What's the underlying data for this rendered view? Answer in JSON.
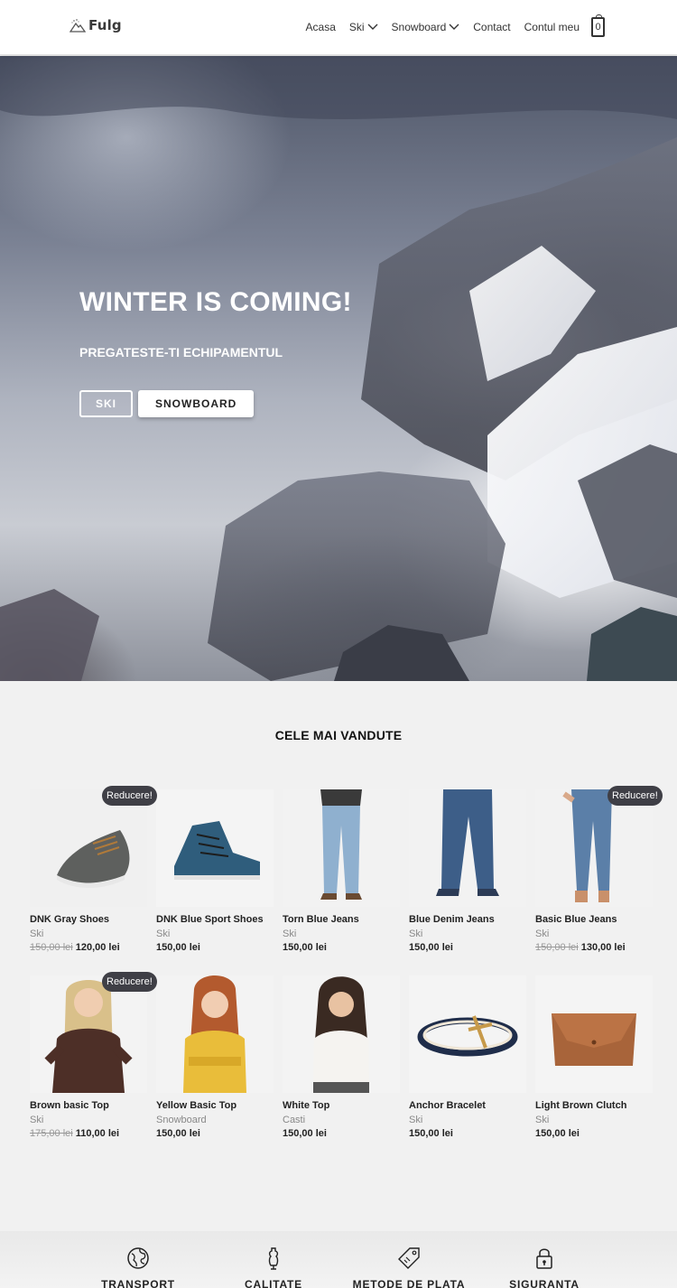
{
  "brand": {
    "name": "Fulg"
  },
  "nav": {
    "items": [
      {
        "label": "Acasa",
        "dropdown": false
      },
      {
        "label": "Ski",
        "dropdown": true
      },
      {
        "label": "Snowboard",
        "dropdown": true
      },
      {
        "label": "Contact",
        "dropdown": false
      },
      {
        "label": "Contul meu",
        "dropdown": false
      }
    ],
    "cart_count": "0"
  },
  "hero": {
    "title": "WINTER IS COMING!",
    "subtitle": "PREGATESTE-TI ECHIPAMENTUL",
    "btn_ski": "SKI",
    "btn_snowboard": "SNOWBOARD"
  },
  "bestsellers": {
    "title": "CELE MAI VANDUTE",
    "badge_label": "Reducere!",
    "products": [
      {
        "name": "DNK Gray Shoes",
        "category": "Ski",
        "old_price": "150,00 lei",
        "price": "120,00 lei",
        "sale": true,
        "image": "gray-shoe"
      },
      {
        "name": "DNK Blue Sport Shoes",
        "category": "Ski",
        "old_price": "",
        "price": "150,00 lei",
        "sale": false,
        "image": "blue-sneaker"
      },
      {
        "name": "Torn Blue Jeans",
        "category": "Ski",
        "old_price": "",
        "price": "150,00 lei",
        "sale": false,
        "image": "torn-jeans"
      },
      {
        "name": "Blue Denim Jeans",
        "category": "Ski",
        "old_price": "",
        "price": "150,00 lei",
        "sale": false,
        "image": "denim-jeans"
      },
      {
        "name": "Basic Blue Jeans",
        "category": "Ski",
        "old_price": "150,00 lei",
        "price": "130,00 lei",
        "sale": true,
        "image": "basic-jeans"
      },
      {
        "name": "Brown basic Top",
        "category": "Ski",
        "old_price": "175,00 lei",
        "price": "110,00 lei",
        "sale": true,
        "image": "brown-top"
      },
      {
        "name": "Yellow Basic Top",
        "category": "Snowboard",
        "old_price": "",
        "price": "150,00 lei",
        "sale": false,
        "image": "yellow-top"
      },
      {
        "name": "White Top",
        "category": "Casti",
        "old_price": "",
        "price": "150,00 lei",
        "sale": false,
        "image": "white-top"
      },
      {
        "name": "Anchor Bracelet",
        "category": "Ski",
        "old_price": "",
        "price": "150,00 lei",
        "sale": false,
        "image": "anchor-bracelet"
      },
      {
        "name": "Light Brown Clutch",
        "category": "Ski",
        "old_price": "",
        "price": "150,00 lei",
        "sale": false,
        "image": "brown-clutch"
      }
    ]
  },
  "features": [
    {
      "label": "TRANSPORT",
      "icon": "globe-icon"
    },
    {
      "label": "CALITATE",
      "icon": "mannequin-icon"
    },
    {
      "label": "METODE DE PLATA",
      "icon": "price-tag-icon"
    },
    {
      "label": "SIGURANTA",
      "icon": "padlock-icon"
    }
  ]
}
